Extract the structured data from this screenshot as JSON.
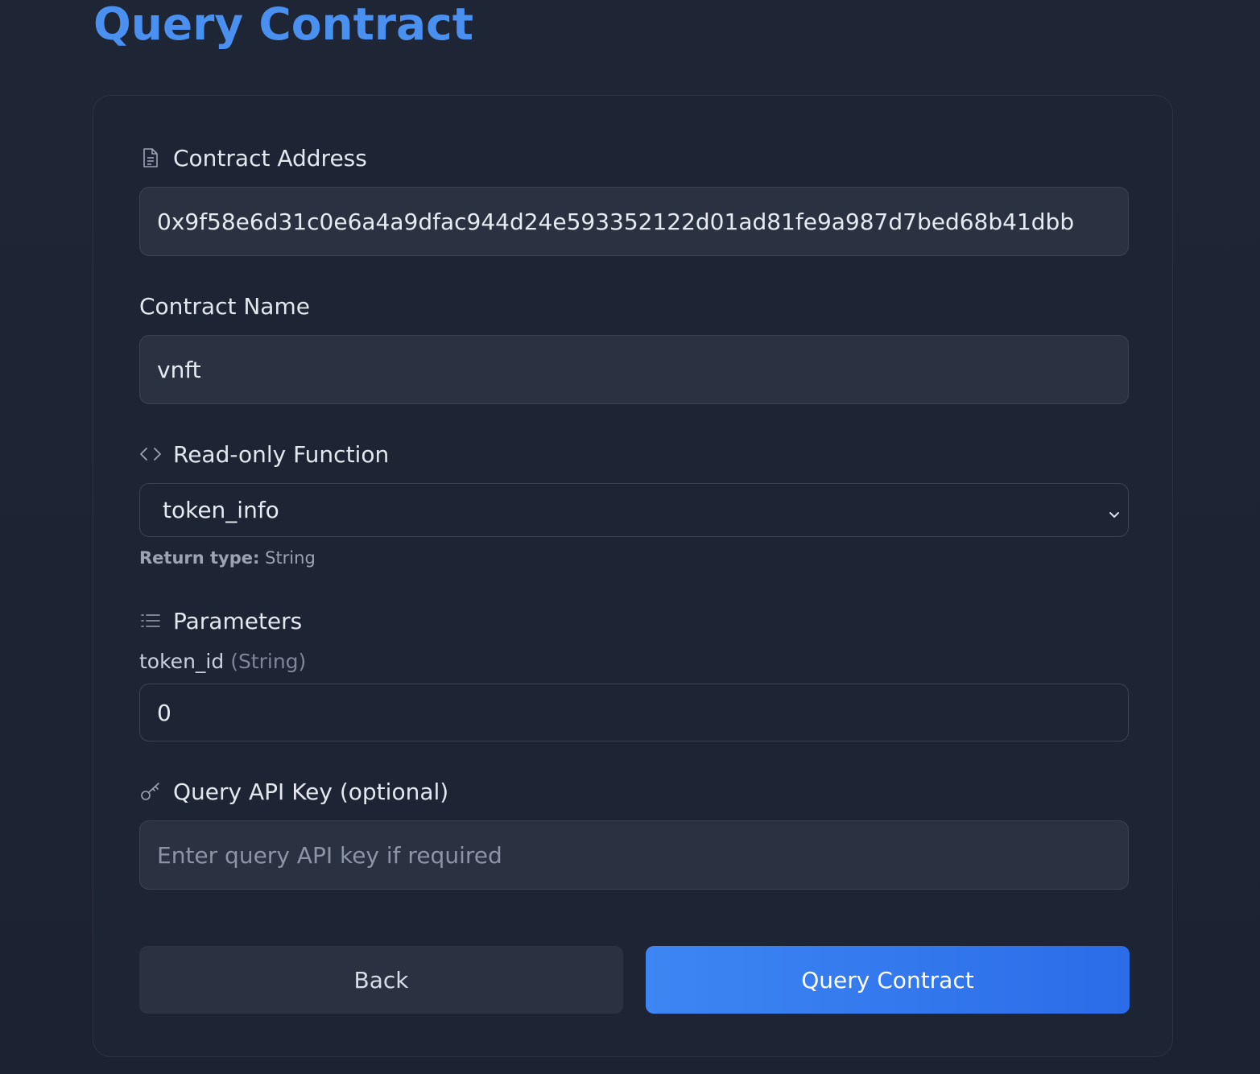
{
  "page": {
    "title": "Query Contract"
  },
  "form": {
    "contract_address": {
      "label": "Contract Address",
      "icon": "document-icon",
      "value": "0x9f58e6d31c0e6a4a9dfac944d24e593352122d01ad81fe9a987d7bed68b41dbb"
    },
    "contract_name": {
      "label": "Contract Name",
      "value": "vnft"
    },
    "function": {
      "label": "Read-only Function",
      "icon": "code-icon",
      "selected": "token_info",
      "return_type_label": "Return type:",
      "return_type_value": "String"
    },
    "parameters": {
      "label": "Parameters",
      "icon": "list-icon",
      "items": [
        {
          "name": "token_id",
          "type": "(String)",
          "value": "0"
        }
      ]
    },
    "api_key": {
      "label": "Query API Key (optional)",
      "icon": "key-icon",
      "placeholder": "Enter query API key if required",
      "value": ""
    }
  },
  "actions": {
    "back_label": "Back",
    "query_label": "Query Contract"
  },
  "colors": {
    "background": "#1e2636",
    "card": "#1d2535",
    "accent": "#3b82f6",
    "title": "#4a90f0"
  }
}
